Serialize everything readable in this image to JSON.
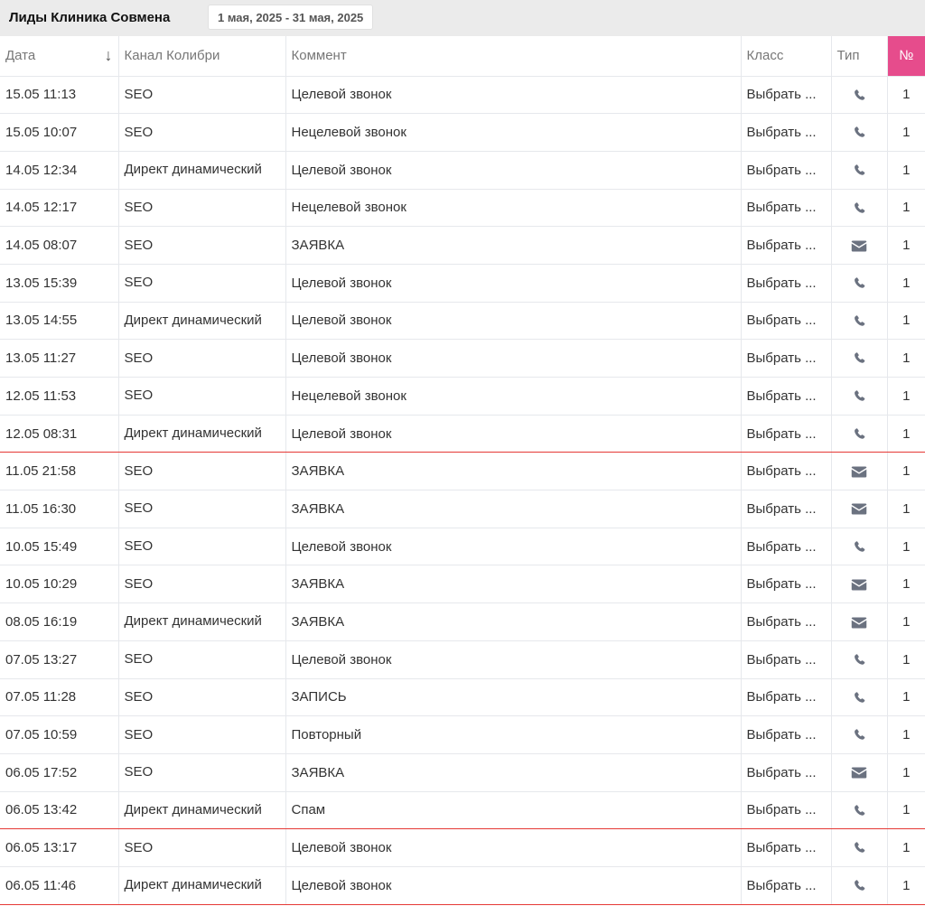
{
  "header": {
    "title": "Лиды Клиника Совмена",
    "date_range": "1 мая, 2025 - 31 мая, 2025"
  },
  "columns": {
    "date": "Дата",
    "channel": "Канал Колибри",
    "comment": "Коммент",
    "class": "Класс",
    "type": "Тип",
    "num": "№"
  },
  "sort_arrow": "↓",
  "colors": {
    "accent": "#e64c8c",
    "highlight_border": "#e53935",
    "icon": "#6b7280"
  },
  "rows": [
    {
      "date": "15.05 11:13",
      "channel": "SEO",
      "comment": "Целевой звонок",
      "class": "Выбрать ...",
      "type": "phone-icon",
      "num": "1",
      "flag": false
    },
    {
      "date": "15.05 10:07",
      "channel": "SEO",
      "comment": "Нецелевой звонок",
      "class": "Выбрать ...",
      "type": "phone-icon",
      "num": "1",
      "flag": false
    },
    {
      "date": "14.05 12:34",
      "channel": "Директ динамический",
      "comment": "Целевой звонок",
      "class": "Выбрать ...",
      "type": "phone-icon",
      "num": "1",
      "flag": false
    },
    {
      "date": "14.05 12:17",
      "channel": "SEO",
      "comment": "Нецелевой звонок",
      "class": "Выбрать ...",
      "type": "phone-icon",
      "num": "1",
      "flag": false
    },
    {
      "date": "14.05 08:07",
      "channel": "SEO",
      "comment": "ЗАЯВКА",
      "class": "Выбрать ...",
      "type": "mail-icon",
      "num": "1",
      "flag": false
    },
    {
      "date": "13.05 15:39",
      "channel": "SEO",
      "comment": "Целевой звонок",
      "class": "Выбрать ...",
      "type": "phone-icon",
      "num": "1",
      "flag": false
    },
    {
      "date": "13.05 14:55",
      "channel": "Директ динамический",
      "comment": "Целевой звонок",
      "class": "Выбрать ...",
      "type": "phone-icon",
      "num": "1",
      "flag": false
    },
    {
      "date": "13.05 11:27",
      "channel": "SEO",
      "comment": "Целевой звонок",
      "class": "Выбрать ...",
      "type": "phone-icon",
      "num": "1",
      "flag": false
    },
    {
      "date": "12.05 11:53",
      "channel": "SEO",
      "comment": "Нецелевой звонок",
      "class": "Выбрать ...",
      "type": "phone-icon",
      "num": "1",
      "flag": false
    },
    {
      "date": "12.05 08:31",
      "channel": "Директ динамический",
      "comment": "Целевой звонок",
      "class": "Выбрать ...",
      "type": "phone-icon",
      "num": "1",
      "flag": true
    },
    {
      "date": "11.05 21:58",
      "channel": "SEO",
      "comment": "ЗАЯВКА",
      "class": "Выбрать ...",
      "type": "mail-icon",
      "num": "1",
      "flag": false
    },
    {
      "date": "11.05 16:30",
      "channel": "SEO",
      "comment": "ЗАЯВКА",
      "class": "Выбрать ...",
      "type": "mail-icon",
      "num": "1",
      "flag": false
    },
    {
      "date": "10.05 15:49",
      "channel": "SEO",
      "comment": "Целевой звонок",
      "class": "Выбрать ...",
      "type": "phone-icon",
      "num": "1",
      "flag": false
    },
    {
      "date": "10.05 10:29",
      "channel": "SEO",
      "comment": "ЗАЯВКА",
      "class": "Выбрать ...",
      "type": "mail-icon",
      "num": "1",
      "flag": false
    },
    {
      "date": "08.05 16:19",
      "channel": "Директ динамический",
      "comment": "ЗАЯВКА",
      "class": "Выбрать ...",
      "type": "mail-icon",
      "num": "1",
      "flag": false
    },
    {
      "date": "07.05 13:27",
      "channel": "SEO",
      "comment": "Целевой звонок",
      "class": "Выбрать ...",
      "type": "phone-icon",
      "num": "1",
      "flag": false
    },
    {
      "date": "07.05 11:28",
      "channel": "SEO",
      "comment": "ЗАПИСЬ",
      "class": "Выбрать ...",
      "type": "phone-icon",
      "num": "1",
      "flag": false
    },
    {
      "date": "07.05 10:59",
      "channel": "SEO",
      "comment": "Повторный",
      "class": "Выбрать ...",
      "type": "phone-icon",
      "num": "1",
      "flag": false
    },
    {
      "date": "06.05 17:52",
      "channel": "SEO",
      "comment": "ЗАЯВКА",
      "class": "Выбрать ...",
      "type": "mail-icon",
      "num": "1",
      "flag": false
    },
    {
      "date": "06.05 13:42",
      "channel": "Директ динамический",
      "comment": "Спам",
      "class": "Выбрать ...",
      "type": "phone-icon",
      "num": "1",
      "flag": true
    },
    {
      "date": "06.05 13:17",
      "channel": "SEO",
      "comment": "Целевой звонок",
      "class": "Выбрать ...",
      "type": "phone-icon",
      "num": "1",
      "flag": false
    },
    {
      "date": "06.05 11:46",
      "channel": "Директ динамический",
      "comment": "Целевой звонок",
      "class": "Выбрать ...",
      "type": "phone-icon",
      "num": "1",
      "flag": true
    }
  ]
}
